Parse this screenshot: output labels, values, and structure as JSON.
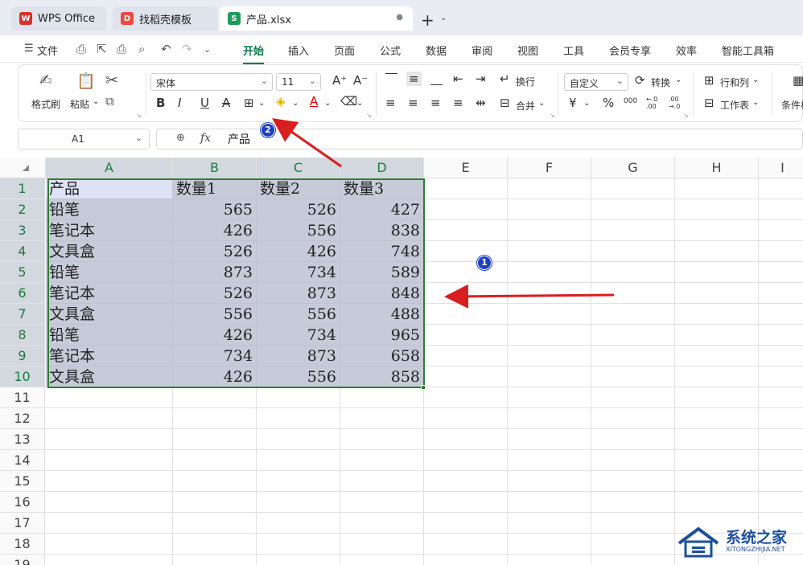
{
  "tabs": [
    {
      "label": "WPS Office",
      "icon": "wps-logo-icon",
      "color": "#d6322e"
    },
    {
      "label": "找稻壳模板",
      "icon": "docer-icon",
      "color": "#e84c3d"
    },
    {
      "label": "产品.xlsx",
      "icon": "spreadsheet-icon",
      "color": "#1e9b57",
      "active": true,
      "unsaved_marker": "●"
    }
  ],
  "new_tab": {
    "plus": "+",
    "dropdown": "⌄"
  },
  "menu": {
    "file": "文件",
    "items": [
      "开始",
      "插入",
      "页面",
      "公式",
      "数据",
      "审阅",
      "视图",
      "工具",
      "会员专享",
      "效率",
      "智能工具箱"
    ],
    "active": "开始"
  },
  "ribbon": {
    "format_painter": "格式刷",
    "paste": "粘贴",
    "font_name": "宋体",
    "font_size": "11",
    "bold": "B",
    "italic": "I",
    "underline": "U",
    "strike": "A",
    "wrap": "换行",
    "merge": "合并",
    "number_format": "自定义",
    "convert": "转换",
    "currency": "¥",
    "percent": "%",
    "thousands": "000",
    "inc_decimal": "←.0\n.00",
    "dec_decimal": ".00\n→.0",
    "row_col": "行和列",
    "worksheet": "工作表",
    "conditional": "条件格"
  },
  "formula_bar": {
    "cell_ref": "A1",
    "fx": "fx",
    "value": "产品"
  },
  "columns": [
    "A",
    "B",
    "C",
    "D",
    "E",
    "F",
    "G",
    "H",
    "I"
  ],
  "rows": [
    "1",
    "2",
    "3",
    "4",
    "5",
    "6",
    "7",
    "8",
    "9",
    "10",
    "11",
    "12",
    "13",
    "14",
    "15",
    "16",
    "17",
    "18",
    "19"
  ],
  "table": {
    "headers": [
      "产品",
      "数量1",
      "数量2",
      "数量3"
    ],
    "data": [
      [
        "铅笔",
        "565",
        "526",
        "427"
      ],
      [
        "笔记本",
        "426",
        "556",
        "838"
      ],
      [
        "文具盒",
        "526",
        "426",
        "748"
      ],
      [
        "铅笔",
        "873",
        "734",
        "589"
      ],
      [
        "笔记本",
        "526",
        "873",
        "848"
      ],
      [
        "文具盒",
        "556",
        "556",
        "488"
      ],
      [
        "铅笔",
        "426",
        "734",
        "965"
      ],
      [
        "笔记本",
        "734",
        "873",
        "658"
      ],
      [
        "文具盒",
        "426",
        "556",
        "858"
      ]
    ]
  },
  "annotations": {
    "badge1": "1",
    "badge2": "2",
    "arrow_color": "#d81e1e"
  },
  "watermark": {
    "text": "系统之家",
    "url": "XITONGZHIJIA.NET"
  },
  "colors": {
    "accent": "#0d7c4a",
    "selection_fill": "#c7cbd9",
    "selection_border": "#2e7d32"
  }
}
